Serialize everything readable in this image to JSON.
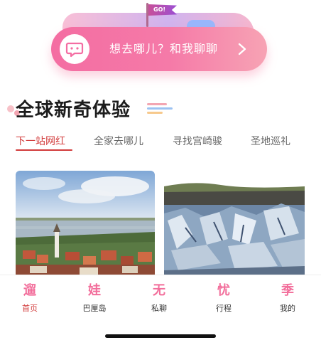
{
  "banner": {
    "flag_text": "GO!",
    "text": "想去哪儿？和我聊聊",
    "icon": "chat-bubble-icon"
  },
  "section": {
    "title": "全球新奇体验"
  },
  "tabs": [
    {
      "label": "下一站网红",
      "active": true
    },
    {
      "label": "全家去哪儿",
      "active": false
    },
    {
      "label": "寻找宫崎骏",
      "active": false
    },
    {
      "label": "圣地巡礼",
      "active": false
    }
  ],
  "cards": [
    {
      "name": "river-town-photo"
    },
    {
      "name": "glacier-photo"
    }
  ],
  "nav": [
    {
      "glyph": "遛",
      "label": "首页",
      "active": true,
      "icon": "home-icon"
    },
    {
      "glyph": "娃",
      "label": "巴厘岛",
      "active": false,
      "icon": "island-icon"
    },
    {
      "glyph": "无",
      "label": "私聊",
      "active": false,
      "icon": "chat-icon"
    },
    {
      "glyph": "忧",
      "label": "行程",
      "active": false,
      "icon": "itinerary-icon"
    },
    {
      "glyph": "季",
      "label": "我的",
      "active": false,
      "icon": "profile-icon"
    }
  ],
  "colors": {
    "accent": "#d23b3b",
    "banner_pink": "#f46da2",
    "nav_pink": "#f26e9b"
  }
}
